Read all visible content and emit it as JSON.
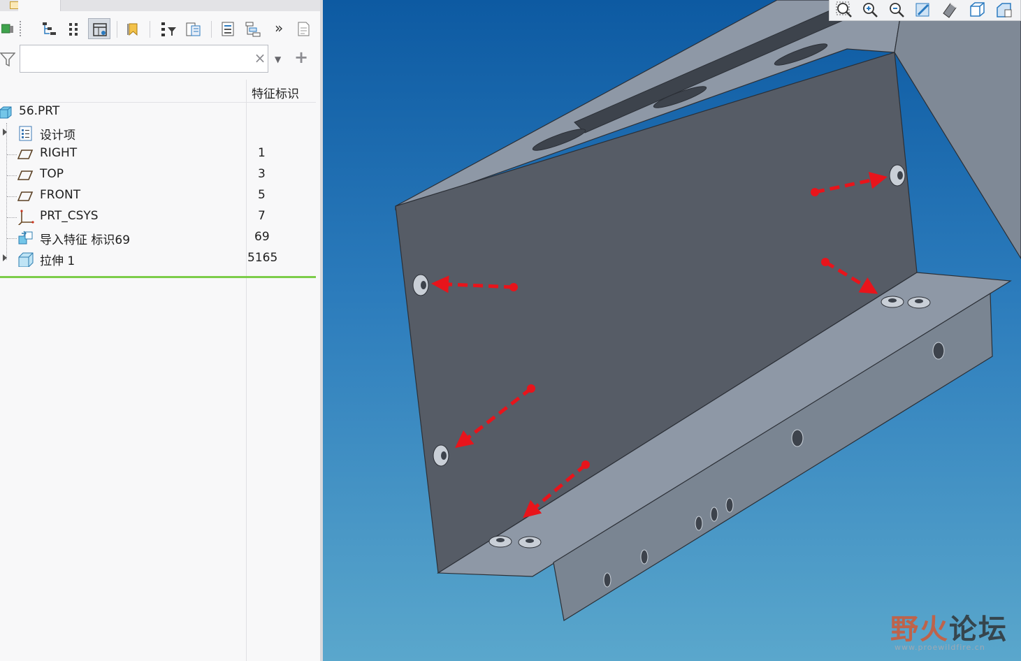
{
  "filter": {
    "search_value": "",
    "search_placeholder": "",
    "clear_glyph": "×",
    "dropdown_glyph": "▼",
    "add_glyph": "+"
  },
  "tree": {
    "column_header": "特征标识",
    "root": {
      "label": "56.PRT",
      "icon": "part-icon"
    },
    "items": [
      {
        "label": "设计项",
        "id": "",
        "icon": "design-items-icon",
        "expandable": true
      },
      {
        "label": "RIGHT",
        "id": "1",
        "icon": "datum-plane-icon",
        "expandable": false
      },
      {
        "label": "TOP",
        "id": "3",
        "icon": "datum-plane-icon",
        "expandable": false
      },
      {
        "label": "FRONT",
        "id": "5",
        "icon": "datum-plane-icon",
        "expandable": false
      },
      {
        "label": "PRT_CSYS",
        "id": "7",
        "icon": "coordinate-system-icon",
        "expandable": false
      },
      {
        "label": "导入特征 标识69",
        "id": "69",
        "icon": "import-feature-icon",
        "expandable": false
      },
      {
        "label": "拉伸 1",
        "id": "5165",
        "icon": "extrude-icon",
        "expandable": true
      }
    ]
  },
  "toolbar": {
    "more_glyph": "»",
    "icons": [
      "show-tree-icon",
      "tree-filter-icon",
      "column-layout-icon",
      "bookmark-icon",
      "filter-settings-icon",
      "tree-columns-icon",
      "settings-list-icon",
      "layer-tree-icon",
      "more-icon",
      "notes-icon"
    ]
  },
  "graphics_toolbar": {
    "icons": [
      "refit-icon",
      "zoom-in-icon",
      "zoom-out-icon",
      "repaint-icon",
      "display-style-icon",
      "saved-views-icon",
      "view-manager-icon"
    ]
  },
  "watermark": {
    "text_a": "野火",
    "text_b": "论坛",
    "url": "www.proewildfire.cn"
  },
  "colors": {
    "viewport_top": "#0d5aa2",
    "viewport_bottom": "#5aa7cc",
    "part_dark": "#565c66",
    "part_light": "#8e98a6",
    "arrow": "#e8141b",
    "insert_bar": "#7ccd4a"
  }
}
